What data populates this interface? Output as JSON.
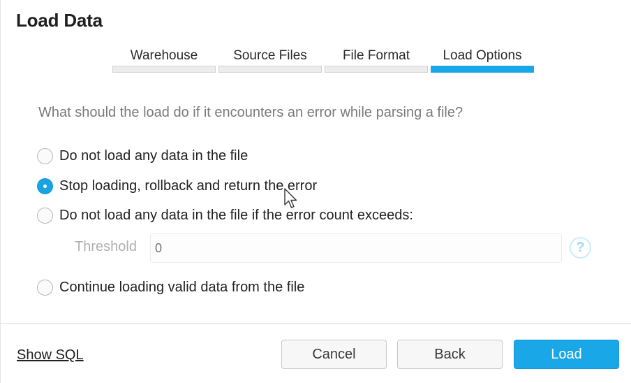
{
  "dialog": {
    "title": "Load Data"
  },
  "steps": [
    {
      "label": "Warehouse",
      "active": false
    },
    {
      "label": "Source Files",
      "active": false
    },
    {
      "label": "File Format",
      "active": false
    },
    {
      "label": "Load Options",
      "active": true
    }
  ],
  "question": "What should the load do if it encounters an error while parsing a file?",
  "options": [
    {
      "label": "Do not load any data in the file",
      "checked": false
    },
    {
      "label": "Stop loading, rollback and return the error",
      "checked": true
    },
    {
      "label": "Do not load any data in the file if the error count exceeds:",
      "checked": false
    },
    {
      "label": "Continue loading valid data from the file",
      "checked": false
    }
  ],
  "threshold": {
    "label": "Threshold",
    "placeholder": "0",
    "help": "?"
  },
  "footer": {
    "show_sql": "Show SQL",
    "cancel": "Cancel",
    "back": "Back",
    "load": "Load"
  },
  "colors": {
    "accent": "#1aa7e8"
  }
}
